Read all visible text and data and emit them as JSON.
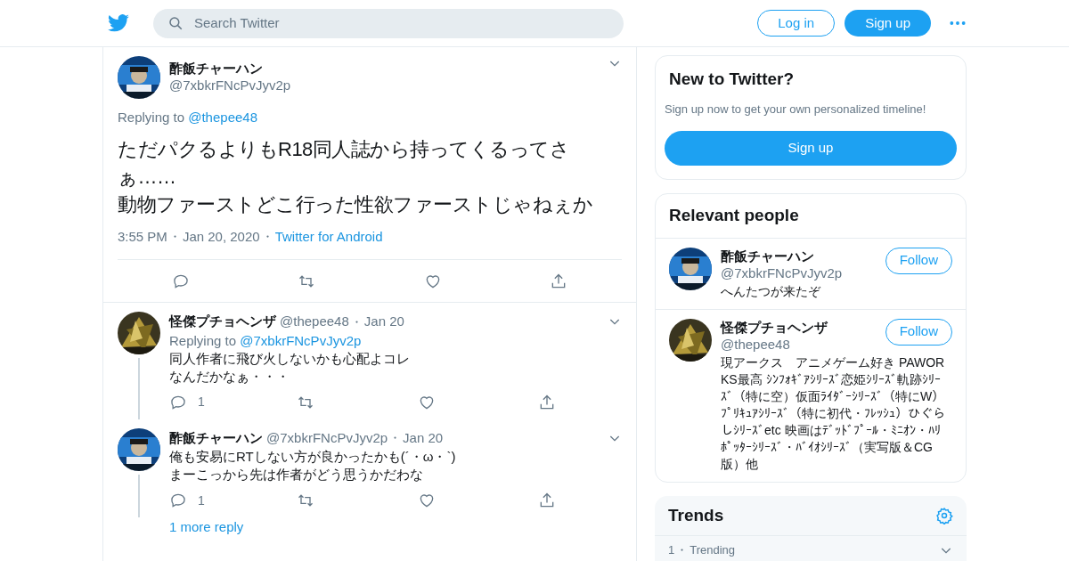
{
  "header": {
    "search": {
      "placeholder": "Search Twitter"
    },
    "login": "Log in",
    "signup": "Sign up"
  },
  "main_tweet": {
    "name": "酢飯チャーハン",
    "handle": "@7xbkrFNcPvJyv2p",
    "replying_label": "Replying to",
    "replying_handle": "@thepee48",
    "lines": [
      "ただパクるよりもR18同人誌から持ってくるってさぁ……",
      "動物ファーストどこ行った性欲ファーストじゃねぇか"
    ],
    "time": "3:55 PM",
    "date": "Jan 20, 2020",
    "source": "Twitter for Android"
  },
  "replies": [
    {
      "name": "怪傑プチョヘンザ",
      "handle": "@thepee48",
      "date": "Jan 20",
      "replying_label": "Replying to",
      "replying_handle": "@7xbkrFNcPvJyv2p",
      "lines": [
        "同人作者に飛び火しないかも心配よコレ",
        "なんだかなぁ・・・"
      ],
      "reply_count": "1"
    },
    {
      "name": "酢飯チャーハン",
      "handle": "@7xbkrFNcPvJyv2p",
      "date": "Jan 20",
      "lines": [
        "俺も安易にRTしない方が良かったかも(´・ω・`)",
        "まーこっから先は作者がどう思うかだわな"
      ],
      "reply_count": "1"
    }
  ],
  "more_replies": "1 more reply",
  "sidebar": {
    "new_to_twitter": {
      "title": "New to Twitter?",
      "subtitle": "Sign up now to get your own personalized timeline!",
      "button": "Sign up"
    },
    "relevant_people": {
      "title": "Relevant people",
      "people": [
        {
          "name": "酢飯チャーハン",
          "handle": "@7xbkrFNcPvJyv2p",
          "bio": "へんたつが来たぞ",
          "follow": "Follow"
        },
        {
          "name": "怪傑プチョヘンザ",
          "handle": "@thepee48",
          "bio": "現アークス　アニメゲーム好き PAWORKS最高 ｼﾝﾌｫｷﾞｱｼﾘｰｽﾞ恋姫ｼﾘｰｽﾞ軌跡ｼﾘｰｽﾞ（特に空）仮面ﾗｲﾀﾞｰｼﾘｰｽﾞ（特にW）ﾌﾟﾘｷｭｱｼﾘｰｽﾞ（特に初代・ﾌﾚｯｼｭ）ひぐらしｼﾘｰｽﾞetc 映画はﾃﾞｯﾄﾞﾌﾟｰﾙ・ﾐﾆｵﾝ・ﾊﾘﾎﾟｯﾀｰｼﾘｰｽﾞ・ﾊﾞｲｵｼﾘｰｽﾞ（実写版＆CG版）他",
          "follow": "Follow"
        }
      ]
    },
    "trends": {
      "title": "Trends",
      "items": [
        {
          "rank": "1",
          "label": "Trending"
        }
      ]
    }
  }
}
